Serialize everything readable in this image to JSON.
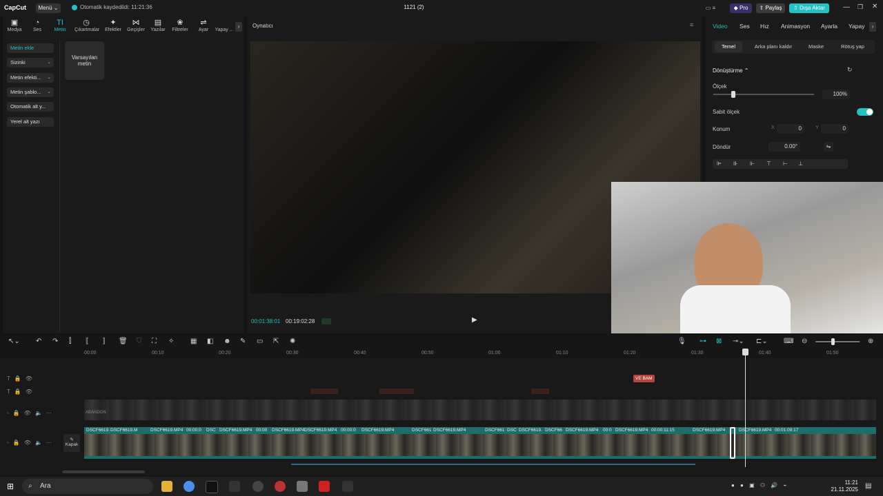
{
  "app": {
    "logo": "CapCut",
    "menu": "Menü",
    "autosave": "Otomatik kaydedildi: 11:21:36",
    "title": "1121 (2)",
    "pro": "Pro",
    "share": "Paylaş",
    "export": "Dışa Aktar"
  },
  "toolbar": {
    "tabs": [
      "Medya",
      "Ses",
      "Metin",
      "Çıkartmalar",
      "Efektler",
      "Geçişler",
      "Yazılar",
      "Filtreler",
      "Ayar",
      "Yapay ..."
    ]
  },
  "left_menu": {
    "items": [
      "Metin ekle",
      "Sizinki",
      "Metin efekti...",
      "Metin şablo...",
      "Otomatik alt y...",
      "Yerel alt yazı"
    ],
    "default_text": "Varsayılan metin"
  },
  "player": {
    "title": "Oynatıcı",
    "current_time": "00:01:38:01",
    "total_time": "00:19:02:28"
  },
  "right": {
    "tabs": [
      "Video",
      "Ses",
      "Hız",
      "Animasyon",
      "Ayarla",
      "Yapay"
    ],
    "subtabs": [
      "Temel",
      "Arka planı kaldır",
      "Maske",
      "Rötuş yap"
    ],
    "transform": "Dönüştürme",
    "scale_label": "Ölçek",
    "scale_value": "100%",
    "uniform_label": "Sabit ölçek",
    "position_label": "Konum",
    "pos_x_label": "X",
    "pos_x": "0",
    "pos_y_label": "Y",
    "pos_y": "0",
    "rotate_label": "Döndür",
    "rotate_value": "0.00°"
  },
  "timeline": {
    "ruler": [
      "00:00",
      "00:10",
      "00:20",
      "00:30",
      "00:40",
      "00:50",
      "01:00",
      "01:10",
      "01:20",
      "01:30",
      "01:40",
      "01:50"
    ],
    "tags": [
      "VE BAM"
    ],
    "clips": [
      "DSCF6619.",
      "DSCF6619.M",
      "DSCF6619.MP4",
      "00:00:0",
      "DSC",
      "DSCF6619.MP4",
      "00:00",
      "DSCF6619.MP4",
      "DSCF6619.MP4",
      "00:00:0",
      "DSCF6619.MP4",
      "DSCF661",
      "DSCF6619.MP4",
      "DSCF661",
      "DSC",
      "DSCF6619.",
      "DSCF66",
      "DSCF6619.MP4",
      "00:0",
      "DSCF6619.MP4",
      "00:00:11:15",
      "DSCF6619.MP4",
      "DSCF6619.MP4",
      "00:01:09:17"
    ],
    "cover": "Kapak",
    "overlay_label": "ABANDON"
  },
  "taskbar": {
    "search": "Ara",
    "time": "11:21",
    "date": "21.11.2025"
  }
}
